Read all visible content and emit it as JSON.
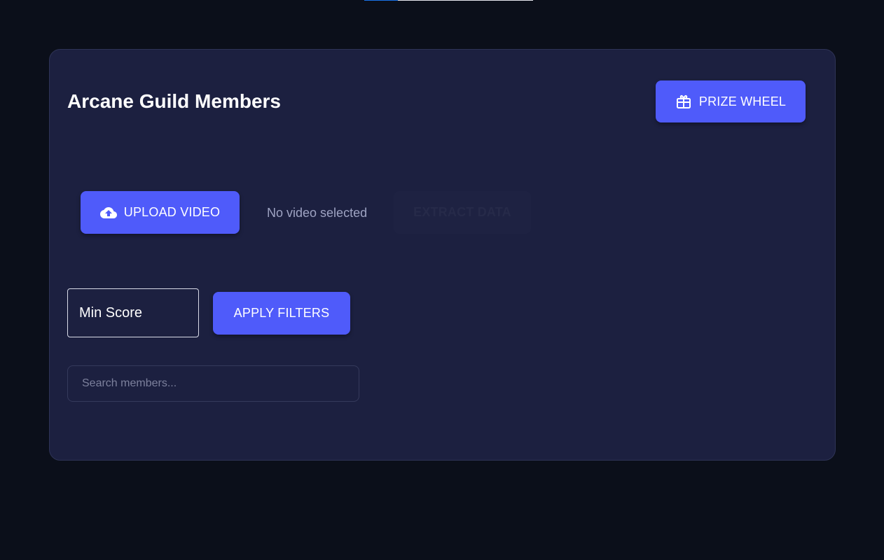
{
  "top_progress": {
    "value_percent": 20,
    "fill_color": "#1a73e8",
    "track_color": "#e6e8ef"
  },
  "header": {
    "title": "Arcane Guild Members",
    "prize_wheel_label": "PRIZE WHEEL",
    "prize_wheel_icon": "gift-icon"
  },
  "upload": {
    "upload_label": "UPLOAD VIDEO",
    "upload_icon": "cloud-upload-icon",
    "file_status": "No video selected",
    "extract_label": "EXTRACT DATA",
    "extract_disabled": true
  },
  "filters": {
    "min_score_placeholder": "Min Score",
    "apply_label": "APPLY FILTERS"
  },
  "search": {
    "placeholder": "Search members..."
  },
  "colors": {
    "page_bg": "#0b0f1a",
    "card_bg": "#1c2040",
    "accent": "#4f5bfa",
    "muted_text": "#9ea3c2"
  }
}
